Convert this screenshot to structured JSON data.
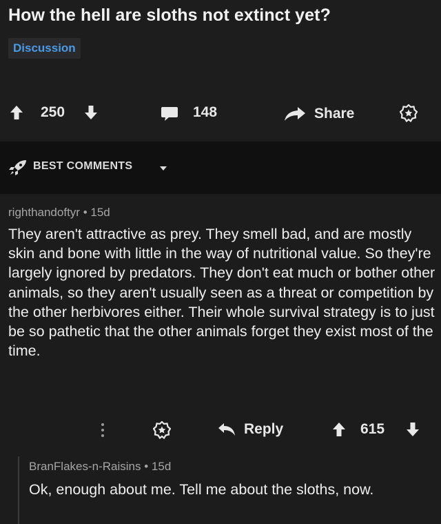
{
  "post": {
    "title": "How the hell are sloths not extinct yet?",
    "flair": "Discussion",
    "score": "250",
    "comment_count": "148",
    "share_label": "Share"
  },
  "sort": {
    "label": "BEST COMMENTS"
  },
  "comment": {
    "author": "righthandoftyr",
    "age": "15d",
    "body": "They aren't attractive as prey.  They smell bad, and are mostly skin and bone with little in the way of nutritional value.  So they're largely ignored by predators.  They don't eat much or bother other animals, so they aren't usually seen as a threat or competition by the other herbivores either.  Their whole survival strategy is to just be so pathetic that the other animals forget they exist most of the time.",
    "reply_label": "Reply",
    "score": "615"
  },
  "reply": {
    "author": "BranFlakes-n-Raisins",
    "age": "15d",
    "body": "Ok, enough about me. Tell me about the sloths, now."
  },
  "colors": {
    "background": "#1c1c1d",
    "sort_bar": "#101011",
    "flair_text": "#4a9ae6",
    "text": "#eeeeee",
    "meta_text": "#a6a6a6"
  }
}
